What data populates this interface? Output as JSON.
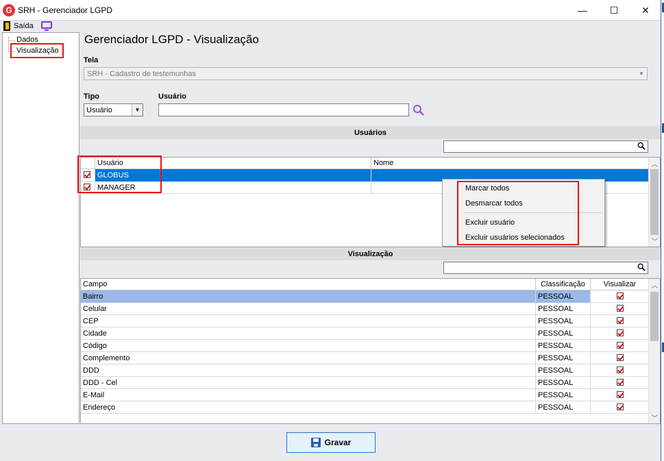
{
  "window": {
    "title": "SRH - Gerenciador LGPD",
    "app_icon_letter": "G",
    "minimize_glyph": "—",
    "maximize_glyph": "☐",
    "close_glyph": "✕"
  },
  "toolbar": {
    "exit_label": "Saída"
  },
  "tree": {
    "items": [
      "Dados",
      "Visualização"
    ],
    "selected": "Visualização"
  },
  "page": {
    "heading": "Gerenciador LGPD - Visualização"
  },
  "tela": {
    "label": "Tela",
    "value": "SRH - Cadastro de testemunhas"
  },
  "filter": {
    "tipo_label": "Tipo",
    "tipo_value": "Usuário",
    "usuario_label": "Usuário",
    "usuario_value": ""
  },
  "users_section": {
    "title": "Usuários",
    "columns": [
      "Usuário",
      "Nome"
    ],
    "rows": [
      {
        "checked": true,
        "usuario": "GLOBUS",
        "nome": "",
        "selected": true
      },
      {
        "checked": true,
        "usuario": "MANAGER",
        "nome": "",
        "selected": false
      }
    ]
  },
  "context_menu": {
    "items": [
      "Marcar todos",
      "Desmarcar todos",
      "Excluir usuário",
      "Excluir usuários selecionados"
    ]
  },
  "view_section": {
    "title": "Visualização",
    "columns": [
      "Campo",
      "Classificação",
      "Visualizar"
    ],
    "rows": [
      {
        "campo": "Bairro",
        "classificacao": "PESSOAL",
        "visualizar": true,
        "selected": true
      },
      {
        "campo": "Celular",
        "classificacao": "PESSOAL",
        "visualizar": true,
        "selected": false
      },
      {
        "campo": "CEP",
        "classificacao": "PESSOAL",
        "visualizar": true,
        "selected": false
      },
      {
        "campo": "Cidade",
        "classificacao": "PESSOAL",
        "visualizar": true,
        "selected": false
      },
      {
        "campo": "Código",
        "classificacao": "PESSOAL",
        "visualizar": true,
        "selected": false
      },
      {
        "campo": "Complemento",
        "classificacao": "PESSOAL",
        "visualizar": true,
        "selected": false
      },
      {
        "campo": "DDD",
        "classificacao": "PESSOAL",
        "visualizar": true,
        "selected": false
      },
      {
        "campo": "DDD - Cel",
        "classificacao": "PESSOAL",
        "visualizar": true,
        "selected": false
      },
      {
        "campo": "E-Mail",
        "classificacao": "PESSOAL",
        "visualizar": true,
        "selected": false
      },
      {
        "campo": "Endereço",
        "classificacao": "PESSOAL",
        "visualizar": true,
        "selected": false
      }
    ]
  },
  "footer": {
    "save_label": "Gravar"
  },
  "colors": {
    "selection_blue": "#0078d7",
    "selection_light": "#9bb8e6",
    "highlight_red": "#e11111",
    "accent_purple": "#8a2be2"
  }
}
